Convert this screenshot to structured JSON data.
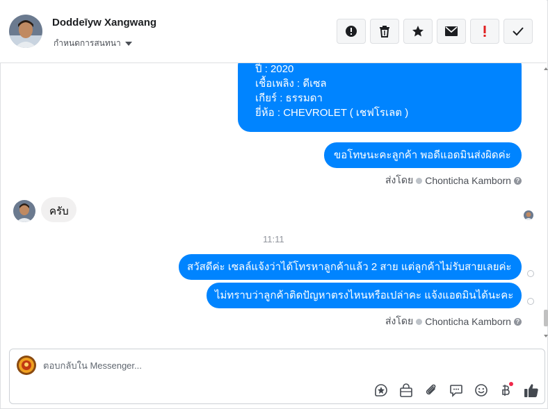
{
  "header": {
    "name": "Doddeīyw Xangwang",
    "subtitle": "กำหนดการสนทนา",
    "actions": [
      "report-icon",
      "trash-icon",
      "star-icon",
      "mail-icon",
      "exclamation-icon",
      "check-icon"
    ]
  },
  "messages": {
    "car_lines": [
      "ปี : 2020",
      "เชื้อเพลิง : ดีเซล",
      "เกียร์ : ธรรมดา",
      "ยี่ห้อ : CHEVROLET ( เชฟโรเลต )"
    ],
    "apology": "ขอโทษนะคะลูกค้า พอดีแอดมินส่งผิดค่ะ",
    "sent_by_1": "ส่งโดย",
    "sender_1": "Chonticha Kamborn",
    "reply_in": "ครับ",
    "timestamp": "11:11",
    "msg_1": "สวัสดีค่ะ เซลล์แจ้งว่าได้โทรหาลูกค้าแล้ว 2 สาย แต่ลูกค้าไม่รับสายเลยค่ะ",
    "msg_2": "ไม่ทราบว่าลูกค้าติดปัญหาตรงไหนหรือเปล่าคะ แจ้งแอดมินได้นะคะ",
    "sent_by_2": "ส่งโดย",
    "sender_2": "Chonticha Kamborn"
  },
  "composer": {
    "placeholder": "ตอบกลับใน Messenger...",
    "tools": [
      "sticker-icon",
      "shopping-bag-icon",
      "paperclip-icon",
      "chat-bubble-icon",
      "emoji-icon",
      "baht-icon",
      "thumbs-up-icon"
    ]
  },
  "colors": {
    "accent": "#0084ff",
    "incoming": "#f1f0f0",
    "notify": "#f02849",
    "exclamation": "#e02020"
  }
}
